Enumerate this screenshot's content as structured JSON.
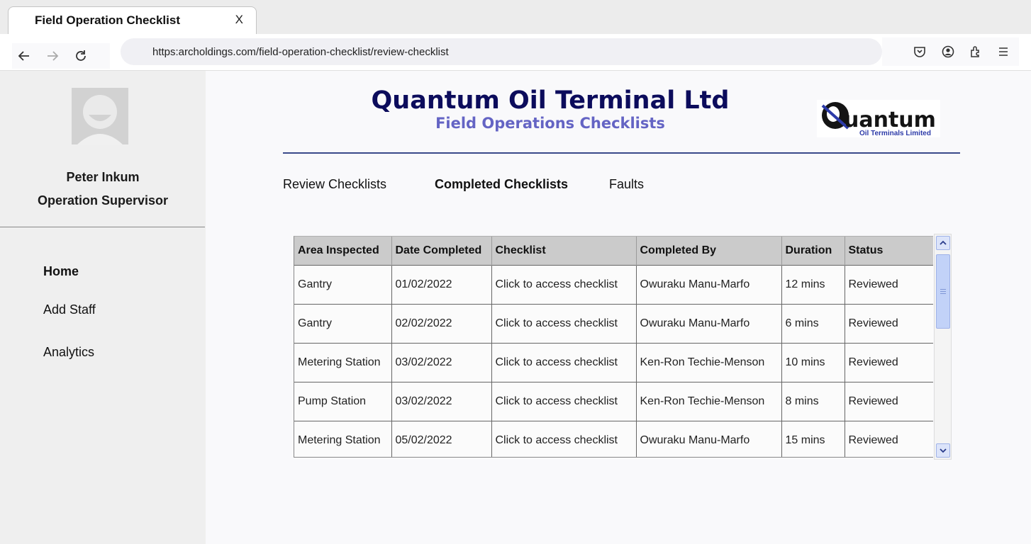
{
  "browser": {
    "tab_title": "Field Operation Checklist",
    "tab_close": "X",
    "url": "https:archoldings.com/field-operation-checklist/review-checklist",
    "icons": [
      "back-icon",
      "forward-icon",
      "reload-icon",
      "pocket-icon",
      "account-icon",
      "extensions-icon",
      "menu-icon"
    ]
  },
  "sidebar": {
    "user_name": "Peter Inkum",
    "user_role": "Operation Supervisor",
    "items": [
      {
        "label": "Home",
        "active": true
      },
      {
        "label": "Add Staff",
        "active": false
      },
      {
        "label": "Analytics",
        "active": false
      }
    ]
  },
  "header": {
    "title": "Quantum Oil Terminal Ltd",
    "subtitle": "Field Operations Checklists",
    "logo_text": "uantum",
    "logo_tagline": "Oil Terminals Limited"
  },
  "tabs": [
    {
      "label": "Review Checklists",
      "active": false
    },
    {
      "label": "Completed Checklists",
      "active": true
    },
    {
      "label": "Faults",
      "active": false
    }
  ],
  "table": {
    "columns": [
      "Area Inspected",
      "Date Completed",
      "Checklist",
      "Completed By",
      "Duration",
      "Status"
    ],
    "rows": [
      [
        "Gantry",
        "01/02/2022",
        "Click to access checklist",
        "Owuraku Manu-Marfo",
        "12 mins",
        "Reviewed"
      ],
      [
        "Gantry",
        "02/02/2022",
        "Click to access checklist",
        "Owuraku Manu-Marfo",
        "6 mins",
        "Reviewed"
      ],
      [
        "Metering Station",
        "03/02/2022",
        "Click to access checklist",
        "Ken-Ron Techie-Menson",
        "10 mins",
        "Reviewed"
      ],
      [
        "Pump Station",
        "03/02/2022",
        "Click to access checklist",
        "Ken-Ron Techie-Menson",
        "8 mins",
        "Reviewed"
      ],
      [
        "Metering Station",
        "05/02/2022",
        "Click to access checklist",
        "Owuraku Manu-Marfo",
        "15 mins",
        "Reviewed"
      ]
    ]
  },
  "colors": {
    "title": "#0c0c5c",
    "subtitle": "#6464c4",
    "header_line": "#3a4a8a",
    "table_header": "#cbcbcb",
    "scroll_thumb": "#c2d2f8"
  }
}
